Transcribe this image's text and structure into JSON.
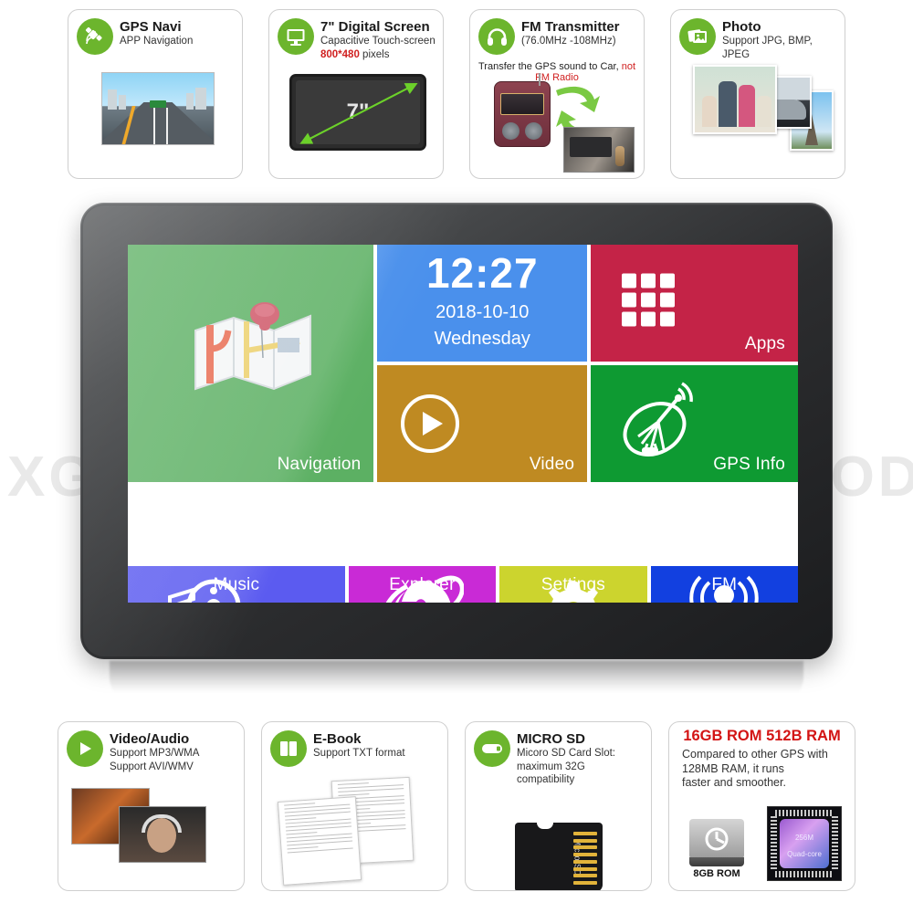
{
  "brand": {
    "watermark": "XGODY",
    "registered": "®"
  },
  "top_cards": [
    {
      "id": "gps-navi",
      "icon": "satellite-icon",
      "title": "GPS Navi",
      "sub1": "APP Navigation",
      "sub2": "",
      "sub2_red": ""
    },
    {
      "id": "digital-screen",
      "icon": "monitor-icon",
      "title": "7\" Digital Screen",
      "sub1": "Capacitive Touch-screen",
      "sub2": "800*480",
      "sub2_tail": " pixels",
      "art_label": "7\""
    },
    {
      "id": "fm-transmitter",
      "icon": "headphones-icon",
      "title": "FM Transmitter",
      "sub1": "(76.0MHz -108MHz)",
      "sub2": "Transfer the GPS sound to Car, ",
      "sub2_red": "not FM Radio"
    },
    {
      "id": "photo",
      "icon": "photo-icon",
      "title": "Photo",
      "sub1": "Support JPG, BMP, JPEG",
      "sub2": ""
    }
  ],
  "bottom_cards": [
    {
      "id": "video-audio",
      "icon": "play-icon",
      "title": "Video/Audio",
      "sub1": "Support MP3/WMA",
      "sub2": "Support AVI/WMV"
    },
    {
      "id": "e-book",
      "icon": "book-icon",
      "title": "E-Book",
      "sub1": "Support TXT format",
      "sub2": ""
    },
    {
      "id": "micro-sd",
      "icon": "sdcard-icon",
      "title": "MICRO SD",
      "sub1": "Micoro SD Card Slot:",
      "sub2": "maximum 32G",
      "sub3": "compatibility",
      "art_label": "Micro SD"
    },
    {
      "id": "memory",
      "icon": "none",
      "title": "16GB ROM 512B RAM",
      "sub1": "Compared to other GPS with",
      "sub2": "128MB RAM, it runs",
      "sub3": "faster and smoother.",
      "hdd_label": "8GB ROM",
      "chip_label_1": "256M",
      "chip_label_2": "Quad-core"
    }
  ],
  "device": {
    "screen": {
      "clock": {
        "time": "12:27",
        "date": "2018-10-10",
        "day": "Wednesday"
      },
      "tiles": [
        {
          "id": "navigation",
          "label": "Navigation",
          "icon": "map-pin-icon",
          "color": "#5cb063"
        },
        {
          "id": "clock",
          "label": "",
          "icon": "clock-text",
          "color": "#4a90ec"
        },
        {
          "id": "apps",
          "label": "Apps",
          "icon": "grid-icon",
          "color": "#c42347"
        },
        {
          "id": "video",
          "label": "Video",
          "icon": "play-circle-icon",
          "color": "#bf8a22"
        },
        {
          "id": "gps-info",
          "label": "GPS Info",
          "icon": "satellite-dish-icon",
          "color": "#0e9a32"
        },
        {
          "id": "music",
          "label": "Music",
          "icon": "music-note-icon",
          "color": "#5b5bf0"
        },
        {
          "id": "explorer",
          "label": "Explorer",
          "icon": "internet-explorer-icon",
          "color": "#c92ad6"
        },
        {
          "id": "settings",
          "label": "Settings",
          "icon": "gear-icon",
          "color": "#ccd42e"
        },
        {
          "id": "fm",
          "label": "FM",
          "icon": "broadcast-icon",
          "color": "#1240e0"
        }
      ]
    }
  }
}
